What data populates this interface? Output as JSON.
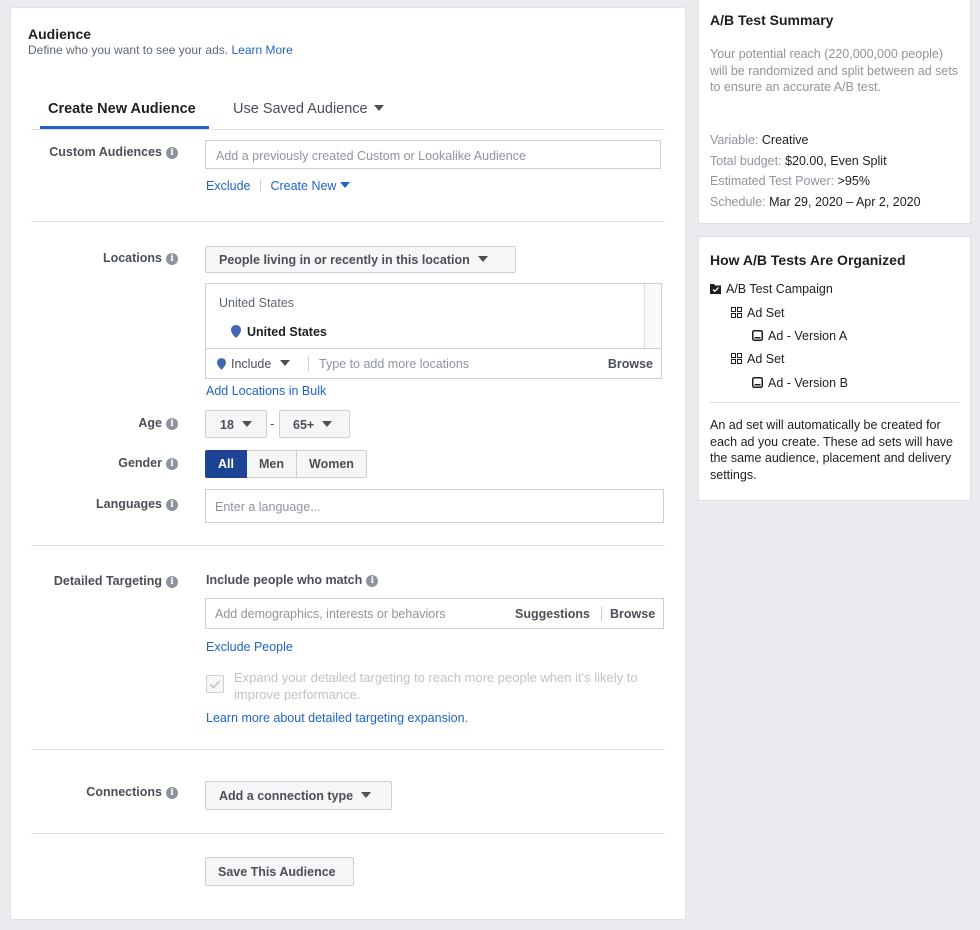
{
  "audience": {
    "title": "Audience",
    "subtitle": "Define who you want to see your ads.",
    "learn_more": "Learn More",
    "tabs": [
      {
        "label": "Create New Audience"
      },
      {
        "label": "Use Saved Audience"
      }
    ],
    "custom_audiences": {
      "label": "Custom Audiences",
      "placeholder": "Add a previously created Custom or Lookalike Audience",
      "exclude": "Exclude",
      "create_new": "Create New"
    },
    "locations": {
      "label": "Locations",
      "dropdown": "People living in or recently in this location",
      "country_header": "United States",
      "selected": "United States",
      "include": "Include",
      "placeholder": "Type to add more locations",
      "browse": "Browse",
      "bulk": "Add Locations in Bulk"
    },
    "age": {
      "label": "Age",
      "min": "18",
      "separator": "-",
      "max": "65+"
    },
    "gender": {
      "label": "Gender",
      "options": [
        "All",
        "Men",
        "Women"
      ],
      "selected": "All"
    },
    "languages": {
      "label": "Languages",
      "placeholder": "Enter a language..."
    },
    "detailed_targeting": {
      "label": "Detailed Targeting",
      "include_label": "Include people who match",
      "placeholder": "Add demographics, interests or behaviors",
      "suggestions": "Suggestions",
      "browse": "Browse",
      "exclude": "Exclude People",
      "expand_text": "Expand your detailed targeting to reach more people when it's likely to improve performance.",
      "expand_checked": true,
      "learn_more": "Learn more about detailed targeting expansion."
    },
    "connections": {
      "label": "Connections",
      "dropdown": "Add a connection type"
    },
    "save_button": "Save This Audience"
  },
  "summary": {
    "title": "A/B Test Summary",
    "description": "Your potential reach (220,000,000 people) will be randomized and split between ad sets to ensure an accurate A/B test.",
    "rows": [
      {
        "key": "Variable:",
        "value": "Creative"
      },
      {
        "key": "Total budget:",
        "value": "$20.00, Even Split"
      },
      {
        "key": "Estimated Test Power:",
        "value": ">95%"
      },
      {
        "key": "Schedule:",
        "value": "Mar 29, 2020 – Apr 2, 2020"
      }
    ]
  },
  "organized": {
    "title": "How A/B Tests Are Organized",
    "campaign": "A/B Test Campaign",
    "ad_set_1": "Ad Set",
    "ad_a": "Ad - Version A",
    "ad_set_2": "Ad Set",
    "ad_b": "Ad - Version B",
    "note": "An ad set will automatically be created for each ad you create. These ad sets will have the same audience, placement and delivery settings."
  },
  "colors": {
    "accent": "#1e63c9",
    "selected_gender_bg": "#1d4394",
    "tab_underline": "#1e63c9"
  },
  "icons": [
    "info-icon",
    "caret-down-icon",
    "location-pin-icon",
    "checkbox-icon",
    "campaign-icon",
    "ad-set-icon",
    "ad-icon"
  ]
}
